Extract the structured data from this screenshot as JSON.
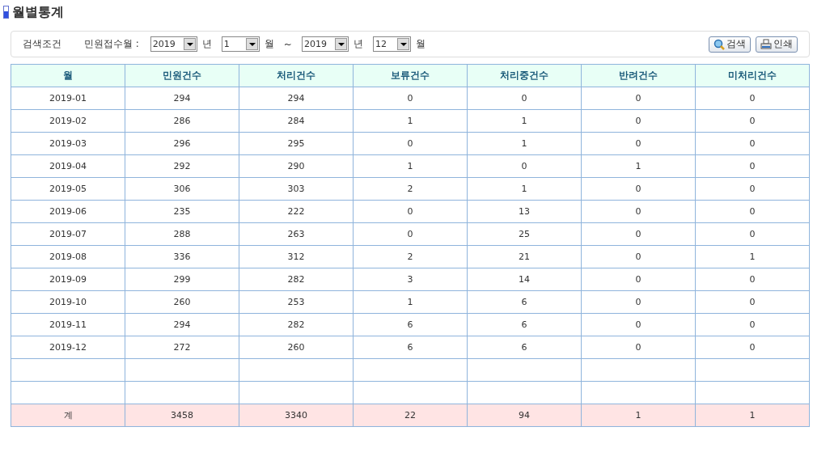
{
  "title": "월별통계",
  "search": {
    "label": "검색조건",
    "field_label": "민원접수월 :",
    "from_year": "2019",
    "from_year_unit": "년",
    "from_month": "1",
    "from_month_unit": "월",
    "range_sep": "~",
    "to_year": "2019",
    "to_year_unit": "년",
    "to_month": "12",
    "to_month_unit": "월",
    "buttons": [
      {
        "kind": "search",
        "label": "검색"
      },
      {
        "kind": "print",
        "label": "인쇄"
      }
    ]
  },
  "table": {
    "columns": [
      "월",
      "민원건수",
      "처리건수",
      "보류건수",
      "처리중건수",
      "반려건수",
      "미처리건수"
    ],
    "rows": [
      [
        "2019-01",
        "294",
        "294",
        "0",
        "0",
        "0",
        "0"
      ],
      [
        "2019-02",
        "286",
        "284",
        "1",
        "1",
        "0",
        "0"
      ],
      [
        "2019-03",
        "296",
        "295",
        "0",
        "1",
        "0",
        "0"
      ],
      [
        "2019-04",
        "292",
        "290",
        "1",
        "0",
        "1",
        "0"
      ],
      [
        "2019-05",
        "306",
        "303",
        "2",
        "1",
        "0",
        "0"
      ],
      [
        "2019-06",
        "235",
        "222",
        "0",
        "13",
        "0",
        "0"
      ],
      [
        "2019-07",
        "288",
        "263",
        "0",
        "25",
        "0",
        "0"
      ],
      [
        "2019-08",
        "336",
        "312",
        "2",
        "21",
        "0",
        "1"
      ],
      [
        "2019-09",
        "299",
        "282",
        "3",
        "14",
        "0",
        "0"
      ],
      [
        "2019-10",
        "260",
        "253",
        "1",
        "6",
        "0",
        "0"
      ],
      [
        "2019-11",
        "294",
        "282",
        "6",
        "6",
        "0",
        "0"
      ],
      [
        "2019-12",
        "272",
        "260",
        "6",
        "6",
        "0",
        "0"
      ]
    ],
    "total": [
      "계",
      "3458",
      "3340",
      "22",
      "94",
      "1",
      "1"
    ]
  }
}
